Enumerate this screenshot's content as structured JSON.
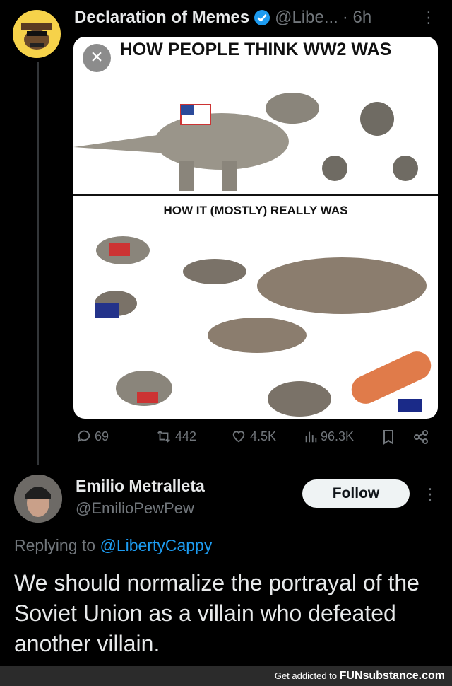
{
  "post": {
    "author_name": "Declaration of Memes",
    "handle": "@Libe...",
    "time": "· 6h",
    "media": {
      "title_top": "HOW PEOPLE THINK WW2 WAS",
      "title_bottom": "HOW IT (MOSTLY) REALLY WAS"
    },
    "stats": {
      "replies": "69",
      "reposts": "442",
      "likes": "4.5K",
      "views": "96.3K"
    }
  },
  "reply": {
    "author_name": "Emilio Metralleta",
    "handle": "@EmilioPewPew",
    "follow_label": "Follow",
    "replying_prefix": "Replying to",
    "replying_mention": "@LibertyCappy",
    "text": "We should normalize the portrayal of the Soviet Union as a villain who defeated another villain."
  },
  "footer": {
    "prefix": "Get addicted to",
    "brand": "FUNsubstance.com"
  },
  "colors": {
    "background": "#000000",
    "text_primary": "#e7e9ea",
    "text_secondary": "#71767b",
    "accent_link": "#1d9bf0",
    "verified": "#1d9bf0"
  }
}
